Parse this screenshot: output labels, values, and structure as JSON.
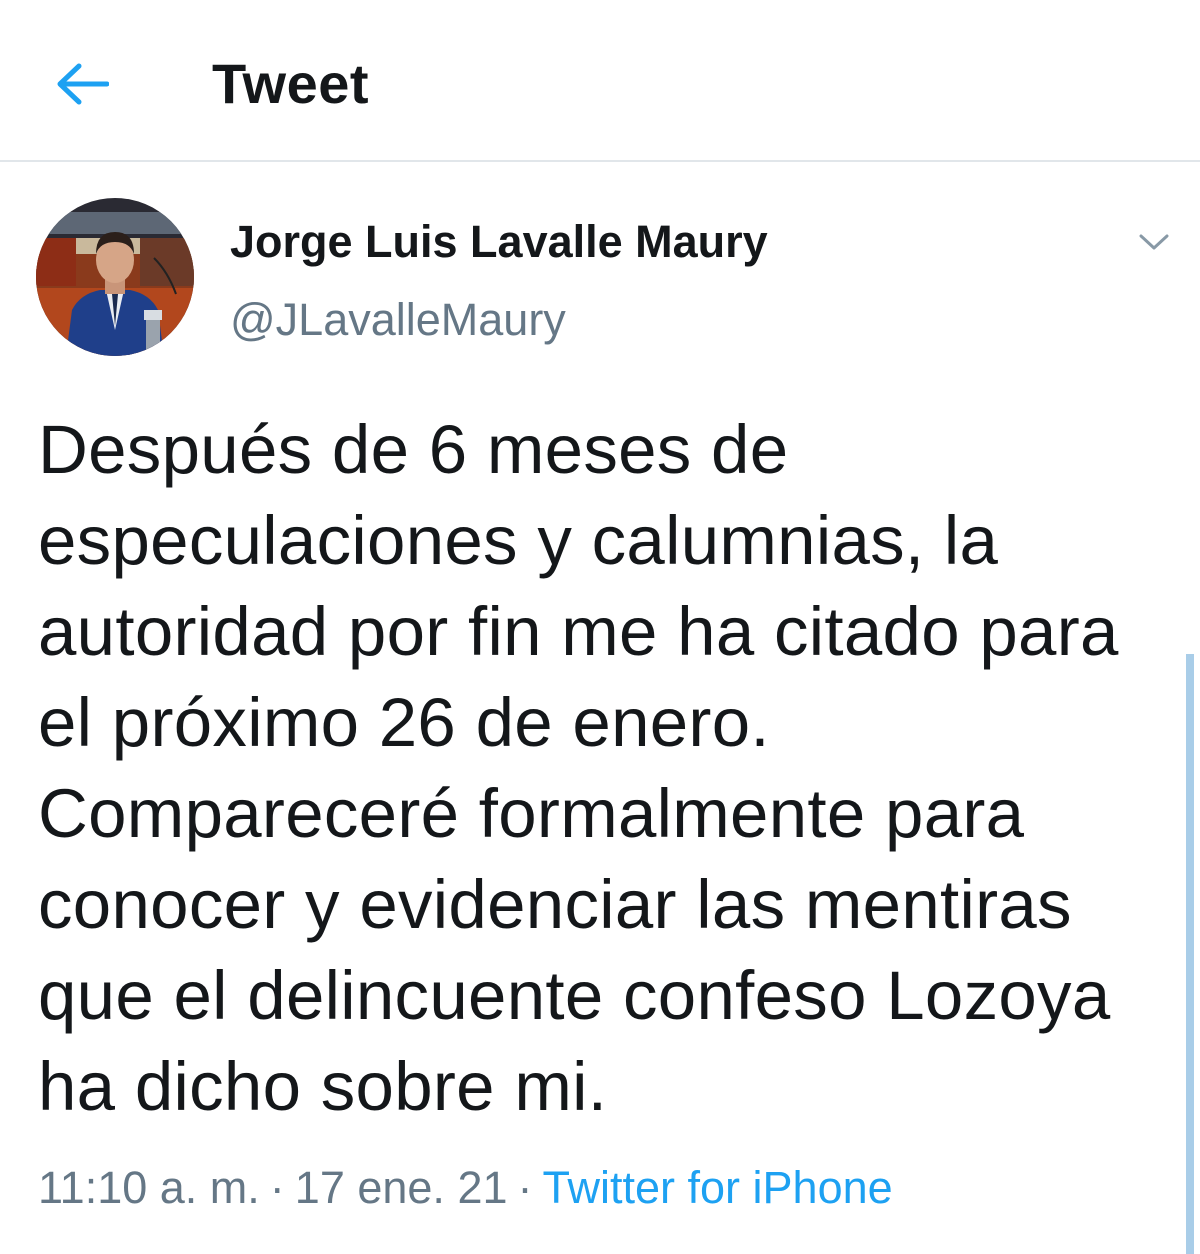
{
  "header": {
    "back_icon": "back-arrow-icon",
    "title": "Tweet"
  },
  "author": {
    "name": "Jorge Luis Lavalle Maury",
    "handle": "@JLavalleMaury",
    "menu_icon": "chevron-down-icon"
  },
  "tweet": {
    "text": "Después de 6 meses de especulaciones y calumnias, la autoridad por fin me ha citado para el próximo 26 de enero. Compareceré formalmente para conocer y evidenciar las mentiras que el delincuente confeso Lozoya ha dicho sobre mi.",
    "time": "11:10 a. m.",
    "date": "17 ene. 21",
    "separator": "·",
    "source": "Twitter for iPhone"
  },
  "colors": {
    "accent": "#1da1f2",
    "text": "#14171a",
    "secondary": "#657786",
    "divider": "#e1e6ea"
  }
}
